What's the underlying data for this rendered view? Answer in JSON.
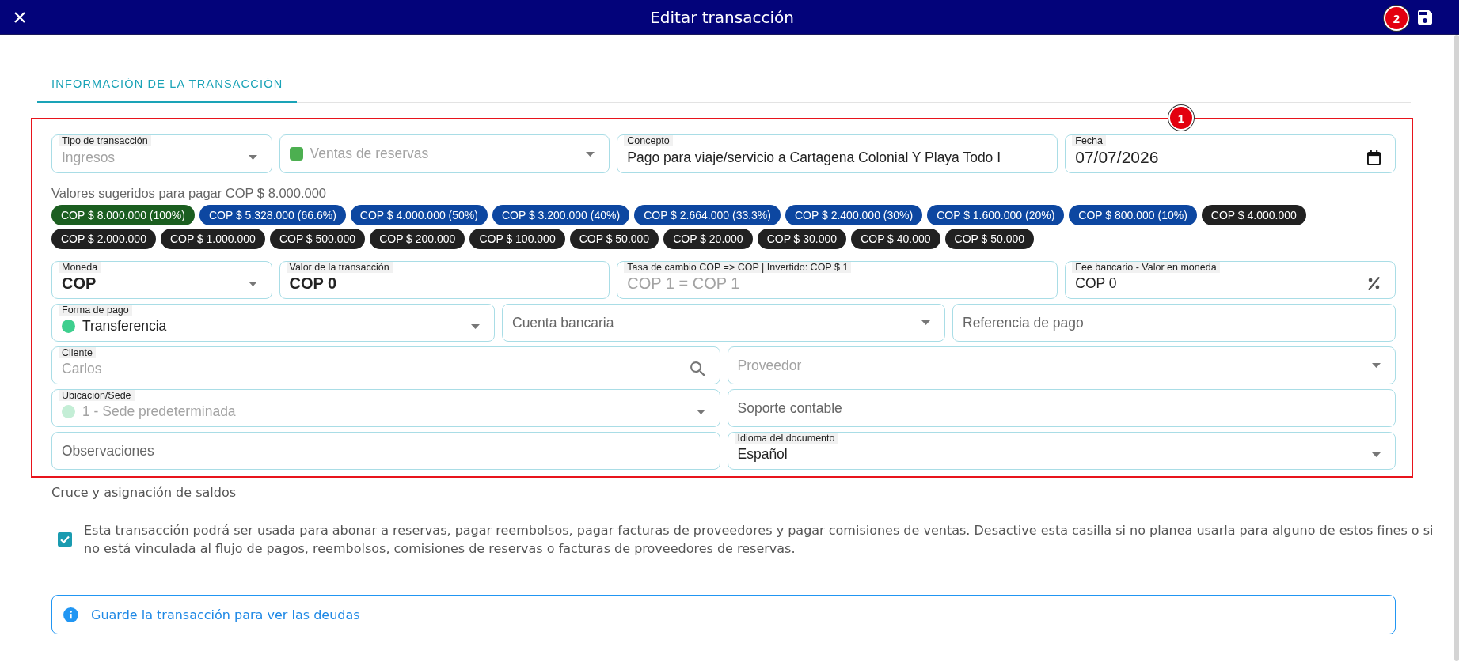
{
  "header": {
    "title": "Editar transacción"
  },
  "tabs": [
    {
      "label": "INFORMACIÓN DE LA TRANSACCIÓN",
      "selected": true
    }
  ],
  "form": {
    "top_row": [
      {
        "kind": "select",
        "label": "Tipo de transacción",
        "value": "Ingresos",
        "disabled": true
      },
      {
        "kind": "select",
        "value": "Ventas de reservas",
        "disabled": true,
        "marker": {
          "kind": "square",
          "color": "#4caf50"
        }
      },
      {
        "kind": "text",
        "label": "Concepto",
        "value": "Pago para viaje/servicio a Cartagena Colonial Y Playa Todo I",
        "disabled": false
      },
      {
        "kind": "date",
        "label": "Fecha",
        "value": "07/07/2026",
        "disabled": false
      }
    ],
    "suggestions": {
      "title": "Valores sugeridos para pagar COP $ 8.000.000",
      "chips": [
        {
          "label": "COP $ 8.000.000 (100%)",
          "color": "#1b5e20"
        },
        {
          "label": "COP $ 5.328.000 (66.6%)",
          "color": "#0d47a1"
        },
        {
          "label": "COP $ 4.000.000 (50%)",
          "color": "#0d47a1"
        },
        {
          "label": "COP $ 3.200.000 (40%)",
          "color": "#0d47a1"
        },
        {
          "label": "COP $ 2.664.000 (33.3%)",
          "color": "#0d47a1"
        },
        {
          "label": "COP $ 2.400.000 (30%)",
          "color": "#0d47a1"
        },
        {
          "label": "COP $ 1.600.000 (20%)",
          "color": "#0d47a1"
        },
        {
          "label": "COP $ 800.000 (10%)",
          "color": "#0d47a1"
        },
        {
          "label": "COP $ 4.000.000",
          "color": "#212121"
        },
        {
          "label": "COP $ 2.000.000",
          "color": "#212121"
        },
        {
          "label": "COP $ 1.000.000",
          "color": "#212121"
        },
        {
          "label": "COP $ 500.000",
          "color": "#212121"
        },
        {
          "label": "COP $ 200.000",
          "color": "#212121"
        },
        {
          "label": "COP $ 100.000",
          "color": "#212121"
        },
        {
          "label": "COP $ 50.000",
          "color": "#212121"
        },
        {
          "label": "COP $ 20.000",
          "color": "#212121"
        },
        {
          "label": "COP $ 30.000",
          "color": "#212121"
        },
        {
          "label": "COP $ 40.000",
          "color": "#212121"
        },
        {
          "label": "COP $ 50.000",
          "color": "#212121"
        }
      ]
    },
    "field_groups": [
      {
        "fields": [
          {
            "kind": "currency",
            "label": "Moneda",
            "value": "COP",
            "disabled": false
          },
          {
            "kind": "amount",
            "label": "Valor de la transacción",
            "value": "COP 0",
            "disabled": false
          },
          {
            "kind": "amount",
            "label": "Tasa de cambio COP => COP | Invertido: COP $ 1",
            "value": "COP 1 = COP 1",
            "disabled": true
          },
          {
            "kind": "percent",
            "label": "Fee bancario - Valor en moneda",
            "value": "COP 0",
            "disabled": false
          }
        ]
      },
      {
        "fields": [
          {
            "kind": "select",
            "label": "Forma de pago",
            "value": "Transferencia",
            "disabled": false,
            "marker": {
              "kind": "dot",
              "color": "#3ecf8e"
            }
          },
          {
            "kind": "select",
            "placeholder": "Cuenta bancaria",
            "disabled": false
          },
          {
            "kind": "text",
            "placeholder": "Referencia de pago",
            "disabled": false
          }
        ]
      },
      {
        "fields": [
          {
            "kind": "search",
            "label": "Cliente",
            "value": "Carlos",
            "disabled": true
          },
          {
            "kind": "select",
            "placeholder": "Proveedor",
            "disabled": true
          }
        ]
      },
      {
        "fields": [
          {
            "kind": "select",
            "label": "Ubicación/Sede",
            "value": "1 - Sede predeterminada",
            "disabled": true,
            "marker": {
              "kind": "dot",
              "color": "#c4eed6"
            }
          },
          {
            "kind": "text",
            "placeholder": "Soporte contable",
            "disabled": false
          }
        ]
      },
      {
        "fields": [
          {
            "kind": "text",
            "placeholder": "Observaciones",
            "disabled": false
          },
          {
            "kind": "select",
            "label": "Idioma del documento",
            "value": "Español",
            "disabled": false
          }
        ]
      }
    ]
  },
  "balance_section": {
    "title": "Cruce y asignación de saldos",
    "checkbox": {
      "checked": true,
      "label": "Esta transacción podrá ser usada para abonar a reservas, pagar reembolsos, pagar facturas de proveedores y pagar comisiones de ventas. Desactive esta casilla si no planea usarla para alguno de estos fines o si no está vinculada al flujo de pagos, reembolsos, comisiones de reservas o facturas de proveedores de reservas."
    }
  },
  "alert": {
    "kind": "info",
    "text": "Guarde la transacción para ver las deudas"
  },
  "annotations": [
    {
      "kind": "frame",
      "label": "1"
    },
    {
      "kind": "badge",
      "label": "2"
    }
  ]
}
